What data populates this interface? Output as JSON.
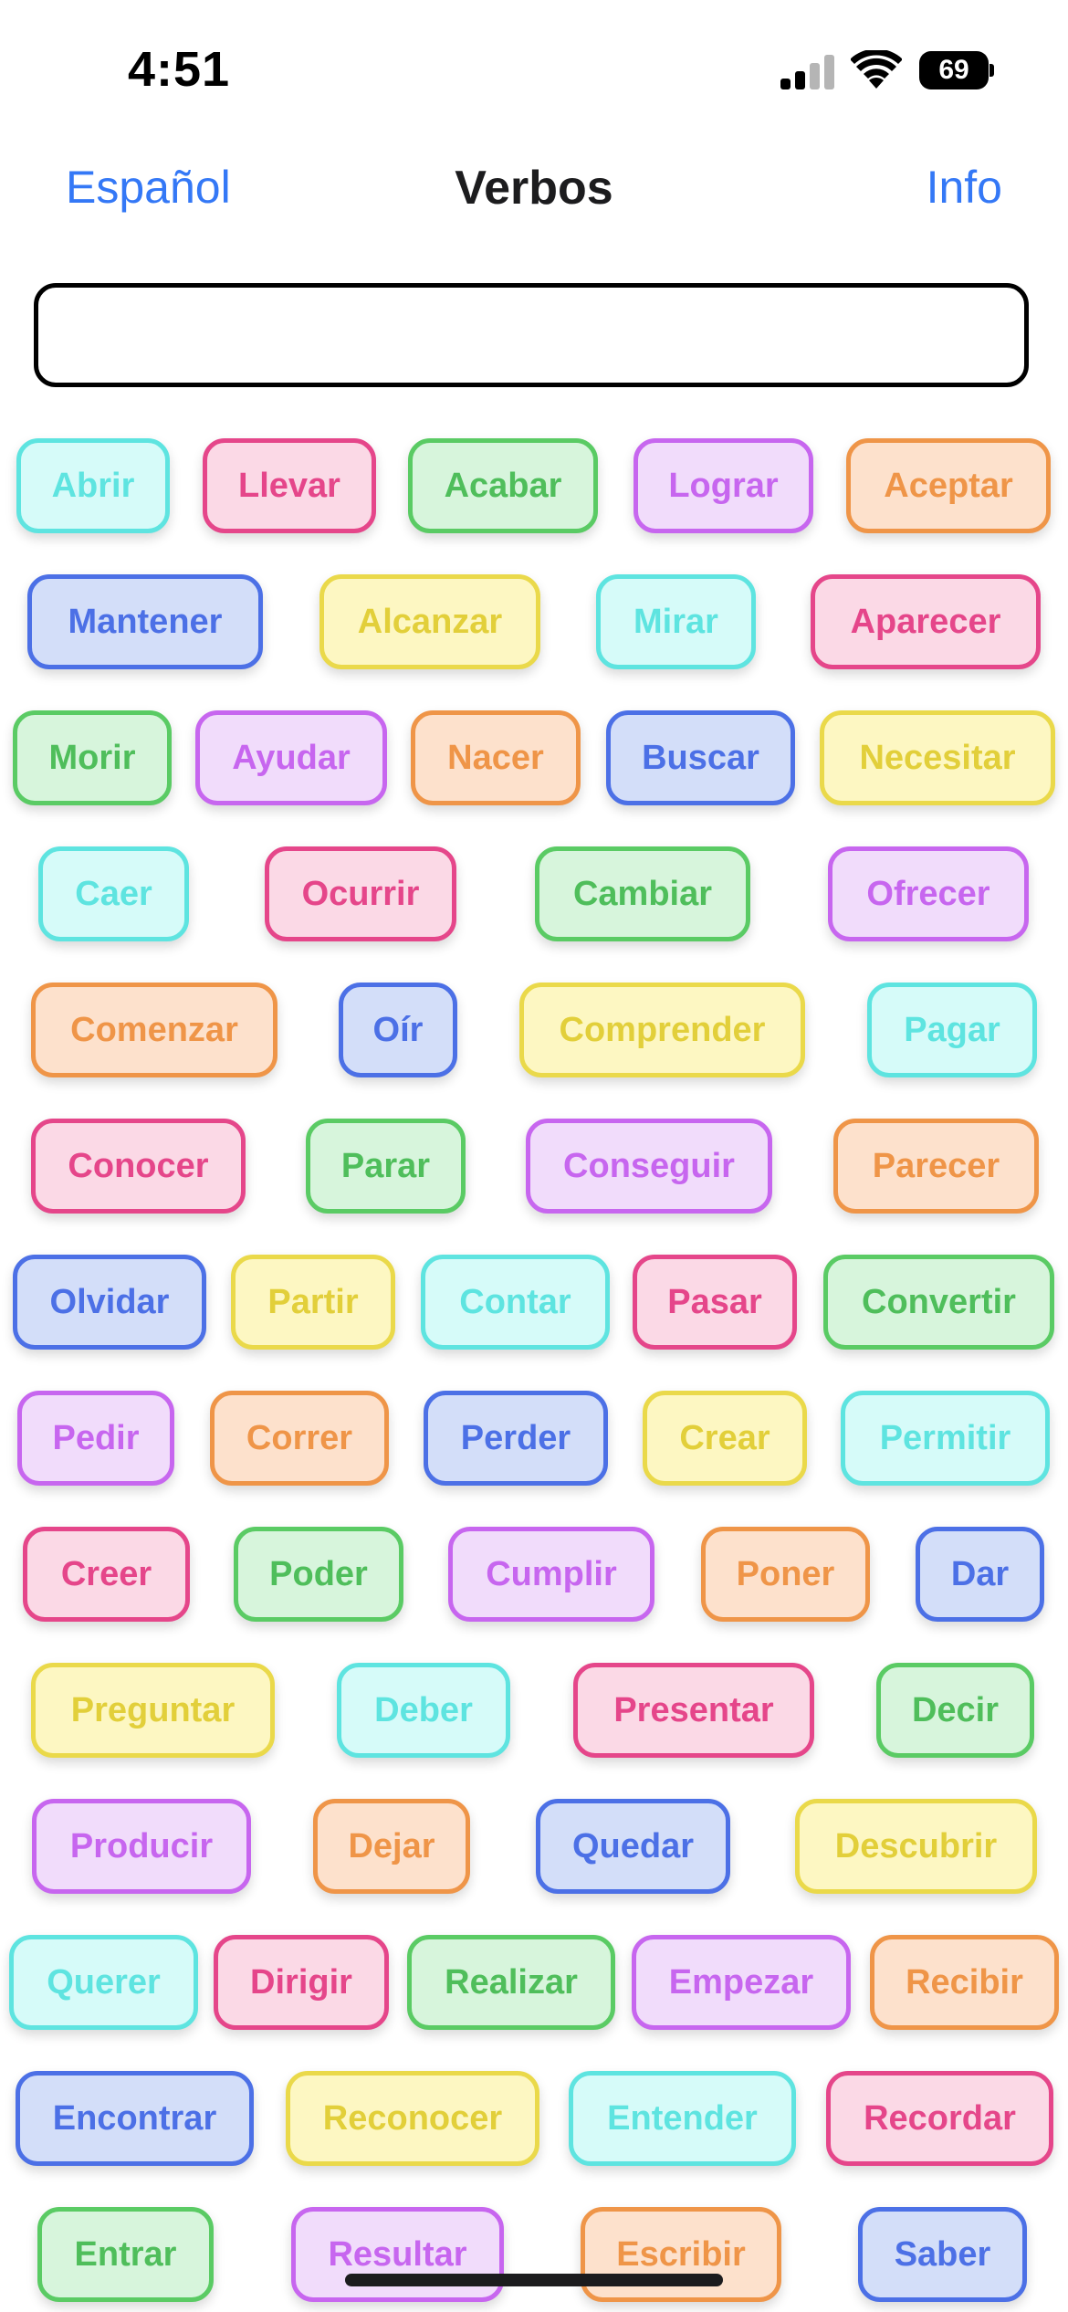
{
  "status_bar": {
    "time": "4:51",
    "battery": "69",
    "signal_icon": "cellular-signal-icon",
    "wifi_icon": "wifi-icon",
    "battery_icon": "battery-icon"
  },
  "nav": {
    "left_label": "Español",
    "title": "Verbos",
    "right_label": "Info"
  },
  "search": {
    "value": "",
    "placeholder": ""
  },
  "colors": {
    "accent": "#3478f6",
    "teal": "#5ee4e0",
    "pink": "#e5468a",
    "green": "#5acb64",
    "purple": "#c766ef",
    "orange": "#ef9548",
    "blue": "#4c70e6",
    "yellow": "#ead94a"
  },
  "verbs": [
    {
      "label": "Abrir",
      "color": "teal"
    },
    {
      "label": "Llevar",
      "color": "pink"
    },
    {
      "label": "Acabar",
      "color": "green"
    },
    {
      "label": "Lograr",
      "color": "purple"
    },
    {
      "label": "Aceptar",
      "color": "orange"
    },
    {
      "label": "Mantener",
      "color": "blue"
    },
    {
      "label": "Alcanzar",
      "color": "yellow"
    },
    {
      "label": "Mirar",
      "color": "teal"
    },
    {
      "label": "Aparecer",
      "color": "pink"
    },
    {
      "label": "Morir",
      "color": "green"
    },
    {
      "label": "Ayudar",
      "color": "purple"
    },
    {
      "label": "Nacer",
      "color": "orange"
    },
    {
      "label": "Buscar",
      "color": "blue"
    },
    {
      "label": "Necesitar",
      "color": "yellow"
    },
    {
      "label": "Caer",
      "color": "teal"
    },
    {
      "label": "Ocurrir",
      "color": "pink"
    },
    {
      "label": "Cambiar",
      "color": "green"
    },
    {
      "label": "Ofrecer",
      "color": "purple"
    },
    {
      "label": "Comenzar",
      "color": "orange"
    },
    {
      "label": "Oír",
      "color": "blue"
    },
    {
      "label": "Comprender",
      "color": "yellow"
    },
    {
      "label": "Pagar",
      "color": "teal"
    },
    {
      "label": "Conocer",
      "color": "pink"
    },
    {
      "label": "Parar",
      "color": "green"
    },
    {
      "label": "Conseguir",
      "color": "purple"
    },
    {
      "label": "Parecer",
      "color": "orange"
    },
    {
      "label": "Olvidar",
      "color": "blue"
    },
    {
      "label": "Partir",
      "color": "yellow"
    },
    {
      "label": "Contar",
      "color": "teal"
    },
    {
      "label": "Pasar",
      "color": "pink"
    },
    {
      "label": "Convertir",
      "color": "green"
    },
    {
      "label": "Pedir",
      "color": "purple"
    },
    {
      "label": "Correr",
      "color": "orange"
    },
    {
      "label": "Perder",
      "color": "blue"
    },
    {
      "label": "Crear",
      "color": "yellow"
    },
    {
      "label": "Permitir",
      "color": "teal"
    },
    {
      "label": "Creer",
      "color": "pink"
    },
    {
      "label": "Poder",
      "color": "green"
    },
    {
      "label": "Cumplir",
      "color": "purple"
    },
    {
      "label": "Poner",
      "color": "orange"
    },
    {
      "label": "Dar",
      "color": "blue"
    },
    {
      "label": "Preguntar",
      "color": "yellow"
    },
    {
      "label": "Deber",
      "color": "teal"
    },
    {
      "label": "Presentar",
      "color": "pink"
    },
    {
      "label": "Decir",
      "color": "green"
    },
    {
      "label": "Producir",
      "color": "purple"
    },
    {
      "label": "Dejar",
      "color": "orange"
    },
    {
      "label": "Quedar",
      "color": "blue"
    },
    {
      "label": "Descubrir",
      "color": "yellow"
    },
    {
      "label": "Querer",
      "color": "teal"
    },
    {
      "label": "Dirigir",
      "color": "pink"
    },
    {
      "label": "Realizar",
      "color": "green"
    },
    {
      "label": "Empezar",
      "color": "purple"
    },
    {
      "label": "Recibir",
      "color": "orange"
    },
    {
      "label": "Encontrar",
      "color": "blue"
    },
    {
      "label": "Reconocer",
      "color": "yellow"
    },
    {
      "label": "Entender",
      "color": "teal"
    },
    {
      "label": "Recordar",
      "color": "pink"
    },
    {
      "label": "Entrar",
      "color": "green"
    },
    {
      "label": "Resultar",
      "color": "purple"
    },
    {
      "label": "Escribir",
      "color": "orange"
    },
    {
      "label": "Saber",
      "color": "blue"
    }
  ]
}
